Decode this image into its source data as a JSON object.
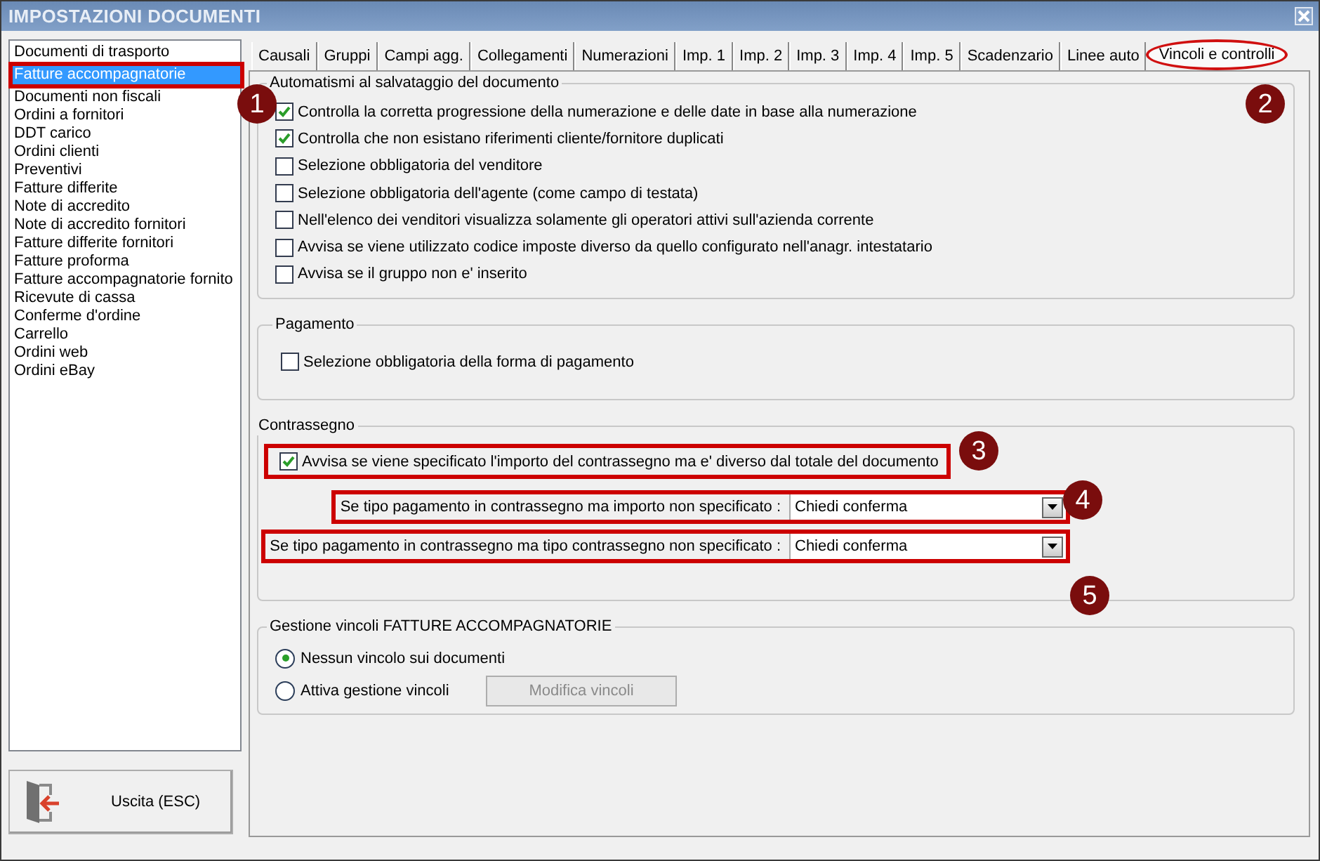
{
  "window": {
    "title": "IMPOSTAZIONI DOCUMENTI"
  },
  "sidebar": {
    "items": [
      {
        "label": "Documenti di trasporto",
        "selected": false,
        "highlighted": false
      },
      {
        "label": "Fatture accompagnatorie",
        "selected": true,
        "highlighted": true
      },
      {
        "label": "Documenti non fiscali",
        "selected": false,
        "highlighted": false
      },
      {
        "label": "Ordini a fornitori",
        "selected": false,
        "highlighted": false
      },
      {
        "label": "DDT carico",
        "selected": false,
        "highlighted": false
      },
      {
        "label": "Ordini clienti",
        "selected": false,
        "highlighted": false
      },
      {
        "label": "Preventivi",
        "selected": false,
        "highlighted": false
      },
      {
        "label": "Fatture differite",
        "selected": false,
        "highlighted": false
      },
      {
        "label": "Note di accredito",
        "selected": false,
        "highlighted": false
      },
      {
        "label": "Note di accredito fornitori",
        "selected": false,
        "highlighted": false
      },
      {
        "label": "Fatture differite fornitori",
        "selected": false,
        "highlighted": false
      },
      {
        "label": "Fatture proforma",
        "selected": false,
        "highlighted": false
      },
      {
        "label": "Fatture accompagnatorie fornito",
        "selected": false,
        "highlighted": false
      },
      {
        "label": "Ricevute di cassa",
        "selected": false,
        "highlighted": false
      },
      {
        "label": "Conferme d'ordine",
        "selected": false,
        "highlighted": false
      },
      {
        "label": "Carrello",
        "selected": false,
        "highlighted": false
      },
      {
        "label": "Ordini web",
        "selected": false,
        "highlighted": false
      },
      {
        "label": "Ordini eBay",
        "selected": false,
        "highlighted": false
      }
    ]
  },
  "exit_button": {
    "label": "Uscita (ESC)"
  },
  "tabs": [
    {
      "label": "Causali",
      "selected": false,
      "highlighted": false
    },
    {
      "label": "Gruppi",
      "selected": false,
      "highlighted": false
    },
    {
      "label": "Campi agg.",
      "selected": false,
      "highlighted": false
    },
    {
      "label": "Collegamenti",
      "selected": false,
      "highlighted": false
    },
    {
      "label": "Numerazioni",
      "selected": false,
      "highlighted": false
    },
    {
      "label": "Imp. 1",
      "selected": false,
      "highlighted": false
    },
    {
      "label": "Imp. 2",
      "selected": false,
      "highlighted": false
    },
    {
      "label": "Imp. 3",
      "selected": false,
      "highlighted": false
    },
    {
      "label": "Imp. 4",
      "selected": false,
      "highlighted": false
    },
    {
      "label": "Imp. 5",
      "selected": false,
      "highlighted": false
    },
    {
      "label": "Scadenzario",
      "selected": false,
      "highlighted": false
    },
    {
      "label": "Linee auto",
      "selected": false,
      "highlighted": false
    },
    {
      "label": "Vincoli e controlli",
      "selected": true,
      "highlighted": true
    }
  ],
  "groups": [
    {
      "title": "Automatismi al salvataggio del documento",
      "items": [
        {
          "kind": "checkbox",
          "label": "Controlla la corretta progressione della numerazione e delle date in base alla numerazione",
          "checked": true,
          "highlighted": false
        },
        {
          "kind": "checkbox",
          "label": "Controlla che non esistano riferimenti cliente/fornitore duplicati",
          "checked": true,
          "highlighted": false
        },
        {
          "kind": "checkbox",
          "label": "Selezione obbligatoria del venditore",
          "checked": false,
          "highlighted": false
        },
        {
          "kind": "checkbox",
          "label": "Selezione obbligatoria dell'agente (come campo di testata)",
          "checked": false,
          "highlighted": false
        },
        {
          "kind": "checkbox",
          "label": "Nell'elenco dei venditori visualizza solamente gli operatori attivi sull'azienda corrente",
          "checked": false,
          "highlighted": false
        },
        {
          "kind": "checkbox",
          "label": "Avvisa se viene utilizzato codice imposte diverso da quello configurato nell'anagr. intestatario",
          "checked": false,
          "highlighted": false
        },
        {
          "kind": "checkbox",
          "label": "Avvisa se il gruppo non e' inserito",
          "checked": false,
          "highlighted": false
        }
      ]
    },
    {
      "title": "Pagamento",
      "items": [
        {
          "kind": "checkbox",
          "label": "Selezione obbligatoria della forma di pagamento",
          "checked": false,
          "highlighted": false
        }
      ]
    },
    {
      "title": "Contrassegno",
      "items": [
        {
          "kind": "checkbox",
          "label": "Avvisa se viene specificato l'importo del contrassegno ma e' diverso dal totale del documento",
          "checked": true,
          "highlighted": true
        },
        {
          "kind": "dropdown",
          "label": "Se tipo pagamento in contrassegno ma importo non specificato :",
          "value": "Chiedi conferma",
          "highlighted": true
        },
        {
          "kind": "dropdown",
          "label": "Se tipo pagamento in contrassegno ma tipo contrassegno non specificato :",
          "value": "Chiedi conferma",
          "highlighted": true
        }
      ]
    },
    {
      "title": "Gestione vincoli FATTURE ACCOMPAGNATORIE",
      "items": [
        {
          "kind": "radio",
          "label": "Nessun vincolo sui documenti",
          "selected": true
        },
        {
          "kind": "radio",
          "label": "Attiva gestione vincoli",
          "selected": false,
          "button": {
            "label": "Modifica vincoli",
            "disabled": true
          }
        }
      ]
    }
  ],
  "callouts": [
    "1",
    "2",
    "3",
    "4",
    "5"
  ]
}
